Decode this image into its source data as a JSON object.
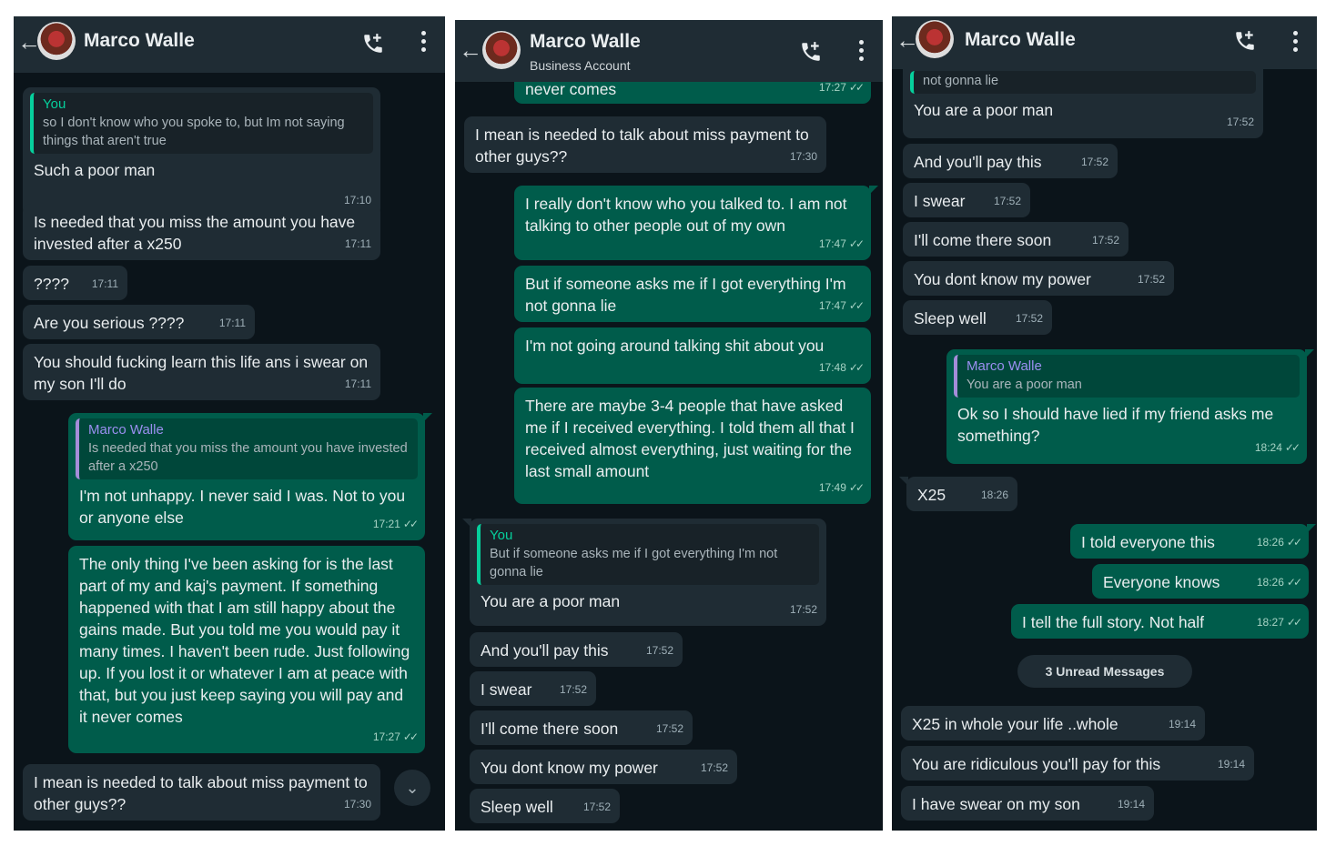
{
  "colors": {
    "background": "#0b141a",
    "header": "#1f2c34",
    "incoming": "#1f2c34",
    "outgoing": "#005c4b",
    "accent": "#06cf9c",
    "quote_other": "#9a8ff0"
  },
  "panels": [
    {
      "contact_name": "Marco Walle",
      "messages": [
        {
          "dir": "in",
          "quote_author": "You",
          "quote_text": "so I don't know who you spoke to, but Im not saying things that aren't true",
          "text": "Such a poor man",
          "time": "17:10"
        },
        {
          "dir": "in",
          "text": "Is needed that you miss the amount you have invested after a x250",
          "time": "17:11"
        },
        {
          "dir": "in",
          "text": "????",
          "time": "17:11"
        },
        {
          "dir": "in",
          "text": "Are you serious ????",
          "time": "17:11"
        },
        {
          "dir": "in",
          "text": "You should fucking learn this life ans i swear on my son I'll do",
          "time": "17:11"
        },
        {
          "dir": "out",
          "quote_author": "Marco Walle",
          "quote_text": "Is needed that you miss the amount you have invested after a x250",
          "text": "I'm not unhappy. I never said I was. Not to you or anyone else",
          "time": "17:21"
        },
        {
          "dir": "out",
          "text": "The only thing I've been asking for is the last part of my and kaj's payment. If something happened with that I am still happy about the gains made. But you told me you would pay it many times. I haven't been rude. Just following up. If you lost it or whatever I am at peace with that, but you just keep saying you will pay and it never comes",
          "time": "17:27"
        },
        {
          "dir": "in",
          "text": "I mean is needed  to talk about miss payment to other guys??",
          "time": "17:30"
        }
      ]
    },
    {
      "contact_name": "Marco Walle",
      "contact_subtitle": "Business Account",
      "messages": [
        {
          "dir": "out",
          "text": "never comes",
          "time": "17:27"
        },
        {
          "dir": "in",
          "text": "I mean is needed  to talk about miss payment to other guys??",
          "time": "17:30"
        },
        {
          "dir": "out",
          "text": "I really don't know who you talked to. I am not talking to other people out of my own",
          "time": "17:47"
        },
        {
          "dir": "out",
          "text": "But if someone asks me if I got everything I'm not gonna lie",
          "time": "17:47"
        },
        {
          "dir": "out",
          "text": "I'm not going around talking shit about you",
          "time": "17:48"
        },
        {
          "dir": "out",
          "text": "There are maybe 3-4 people that have asked me if I received everything. I told them all that I received almost everything, just waiting for the last small amount",
          "time": "17:49"
        },
        {
          "dir": "in",
          "quote_author": "You",
          "quote_text": "But if someone asks me if I got everything I'm not gonna lie",
          "text": "You are a poor man",
          "time": "17:52"
        },
        {
          "dir": "in",
          "text": "And you'll pay this",
          "time": "17:52"
        },
        {
          "dir": "in",
          "text": "I swear",
          "time": "17:52"
        },
        {
          "dir": "in",
          "text": "I'll come there soon",
          "time": "17:52"
        },
        {
          "dir": "in",
          "text": "You dont know my power",
          "time": "17:52"
        },
        {
          "dir": "in",
          "text": "Sleep well",
          "time": "17:52"
        }
      ]
    },
    {
      "contact_name": "Marco Walle",
      "unread_label": "3 Unread Messages",
      "messages": [
        {
          "dir": "in",
          "quote_text": "not gonna lie",
          "text": "You are a poor man",
          "time": "17:52"
        },
        {
          "dir": "in",
          "text": "And you'll pay this",
          "time": "17:52"
        },
        {
          "dir": "in",
          "text": "I swear",
          "time": "17:52"
        },
        {
          "dir": "in",
          "text": "I'll come there soon",
          "time": "17:52"
        },
        {
          "dir": "in",
          "text": "You dont know my power",
          "time": "17:52"
        },
        {
          "dir": "in",
          "text": "Sleep well",
          "time": "17:52"
        },
        {
          "dir": "out",
          "quote_author": "Marco Walle",
          "quote_text": "You are a poor man",
          "text": "Ok so I should have lied if my friend asks me something?",
          "time": "18:24"
        },
        {
          "dir": "in",
          "text": "X25",
          "time": "18:26"
        },
        {
          "dir": "out",
          "text": "I told everyone this",
          "time": "18:26"
        },
        {
          "dir": "out",
          "text": "Everyone knows",
          "time": "18:26"
        },
        {
          "dir": "out",
          "text": "I tell the full story. Not half",
          "time": "18:27"
        },
        {
          "dir": "in",
          "text": "X25 in whole your life ..whole",
          "time": "19:14"
        },
        {
          "dir": "in",
          "text": "You are ridiculous you'll pay for this",
          "time": "19:14"
        },
        {
          "dir": "in",
          "text": "I have swear on my son",
          "time": "19:14"
        }
      ]
    }
  ]
}
